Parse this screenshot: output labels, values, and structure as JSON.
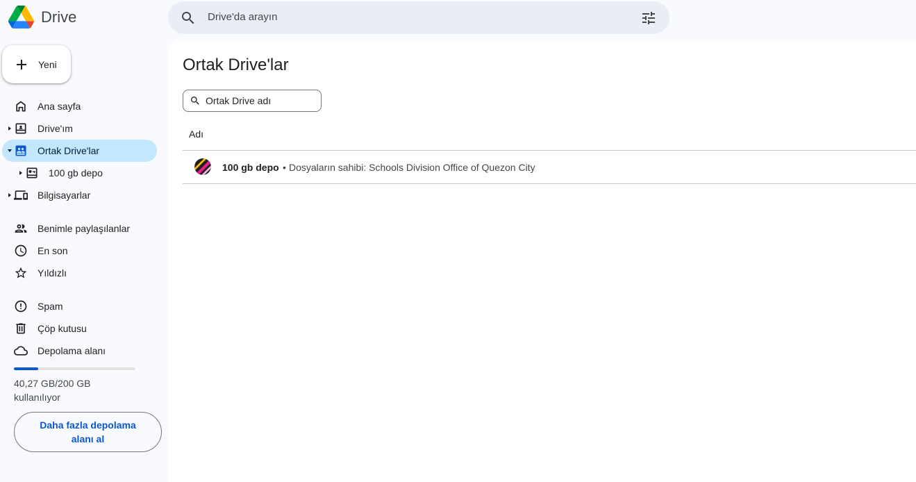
{
  "app": {
    "name": "Drive",
    "logo_icon": "google-drive-logo"
  },
  "search": {
    "placeholder": "Drive'da arayın",
    "icon": "search-icon",
    "filter_icon": "tune-icon"
  },
  "new_button": {
    "label": "Yeni",
    "icon": "plus-icon"
  },
  "sidebar": {
    "items": [
      {
        "label": "Ana sayfa",
        "icon": "home-icon"
      },
      {
        "label": "Drive'ım",
        "icon": "my-drive-icon",
        "expandable": true
      },
      {
        "label": "Ortak Drive'lar",
        "icon": "shared-drives-icon",
        "expandable": true,
        "expanded": true,
        "active": true
      },
      {
        "label": "100 gb depo",
        "icon": "shared-drive-item-icon",
        "expandable": true,
        "child": true
      },
      {
        "label": "Bilgisayarlar",
        "icon": "computers-icon",
        "expandable": true
      },
      {
        "label": "Benimle paylaşılanlar",
        "icon": "people-icon"
      },
      {
        "label": "En son",
        "icon": "clock-icon"
      },
      {
        "label": "Yıldızlı",
        "icon": "star-icon"
      },
      {
        "label": "Spam",
        "icon": "spam-icon"
      },
      {
        "label": "Çöp kutusu",
        "icon": "trash-icon"
      },
      {
        "label": "Depolama alanı",
        "icon": "cloud-icon"
      }
    ]
  },
  "storage": {
    "used_fraction": 0.2,
    "text": "40,27 GB/200 GB kullanılıyor",
    "button_label": "Daha fazla depolama alanı al",
    "bar_color": "#0b57d0"
  },
  "main": {
    "title": "Ortak Drive'lar",
    "filter_placeholder": "Ortak Drive adı",
    "column_header": "Adı",
    "drives": [
      {
        "name": "100 gb depo",
        "separator": "•",
        "owner": "Dosyaların sahibi: Schools Division Office of Quezon City"
      }
    ]
  },
  "colors": {
    "active_nav_bg": "#c2e7ff",
    "search_bg": "#e9eef6",
    "page_bg": "#f8fafd",
    "accent": "#0b57d0"
  }
}
